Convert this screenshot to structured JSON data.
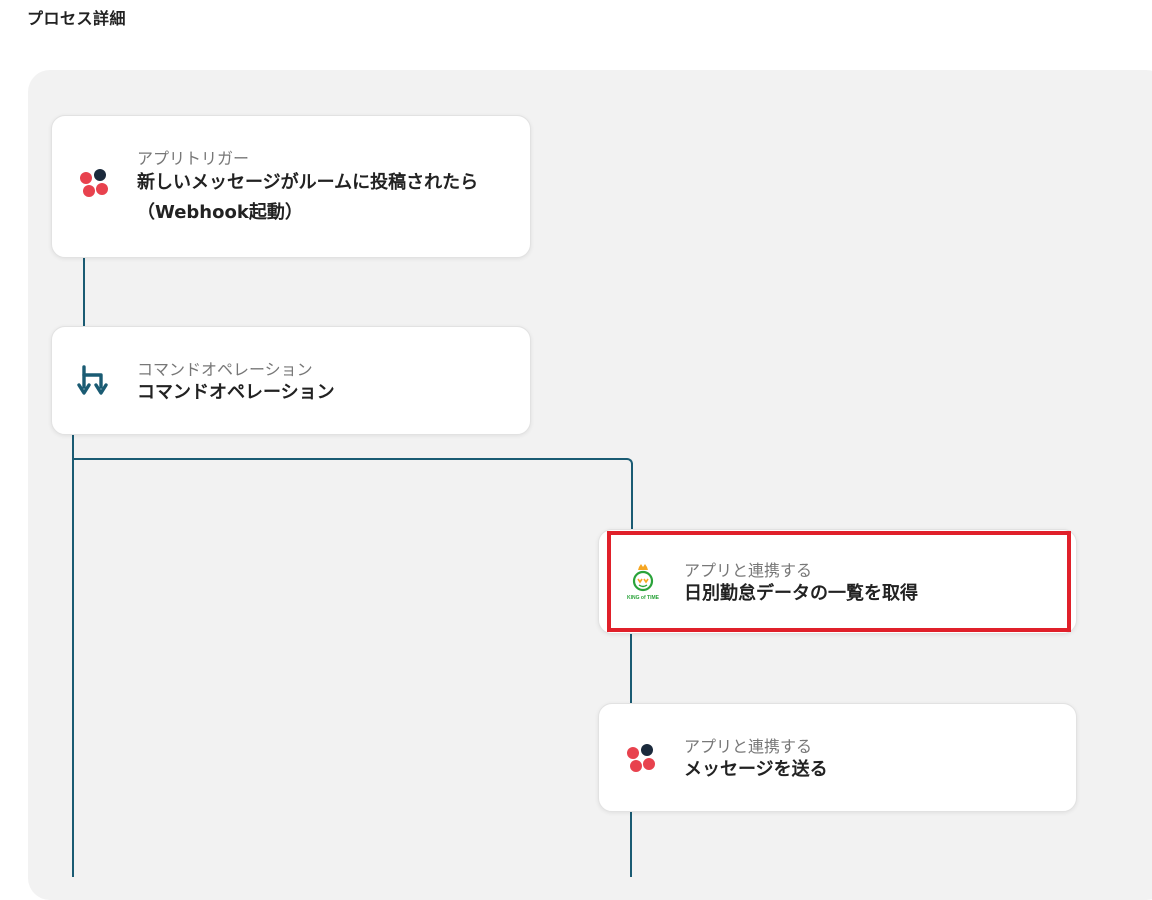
{
  "page": {
    "title": "プロセス詳細"
  },
  "colors": {
    "connector": "#1a5b73",
    "highlight": "#e0202a",
    "canvas_bg": "#f2f2f2",
    "chatwork_red": "#e8424e",
    "chatwork_dark": "#1b2a3c",
    "kot_green": "#2aa33a",
    "kot_orange": "#f5a623"
  },
  "flow": {
    "steps": [
      {
        "label": "アプリトリガー",
        "title_line1": "新しいメッセージがルームに投稿されたら",
        "title_line2": "（Webhook起動）",
        "icon": "chatwork-icon"
      },
      {
        "label": "コマンドオペレーション",
        "title_line1": "コマンドオペレーション",
        "icon": "command-operation-icon"
      },
      {
        "label": "アプリと連携する",
        "title_line1": "日別勤怠データの一覧を取得",
        "icon": "king-of-time-icon",
        "icon_text": "KING of TIME",
        "highlighted": true
      },
      {
        "label": "アプリと連携する",
        "title_line1": "メッセージを送る",
        "icon": "chatwork-icon"
      }
    ]
  }
}
